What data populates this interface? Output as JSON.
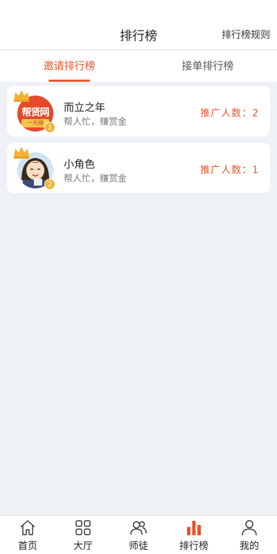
{
  "header": {
    "title": "排行榜",
    "rules_label": "排行榜规则"
  },
  "tabs": [
    {
      "label": "邀请排行榜",
      "active": true
    },
    {
      "label": "接单排行榜",
      "active": false
    }
  ],
  "rankings": [
    {
      "rank": "1",
      "name": "而立之年",
      "slogan": "帮人忙，赚赏金",
      "promo": "推广人数：2",
      "avatar_text": "帮贤网",
      "avatar_subtext": "一元接"
    },
    {
      "rank": "2",
      "name": " 小角色",
      "slogan": "帮人忙，赚赏金",
      "promo": "推广人数：1"
    }
  ],
  "bottom_nav": [
    {
      "label": "首页",
      "icon": "home-icon",
      "active": false
    },
    {
      "label": "大厅",
      "icon": "grid-icon",
      "active": false
    },
    {
      "label": "师徒",
      "icon": "users-icon",
      "active": false
    },
    {
      "label": "排行榜",
      "icon": "bar-chart-icon",
      "active": true
    },
    {
      "label": "我的",
      "icon": "user-icon",
      "active": false
    }
  ],
  "colors": {
    "accent": "#e9552c",
    "background": "#eef1f5",
    "crown": "#f3b232"
  }
}
